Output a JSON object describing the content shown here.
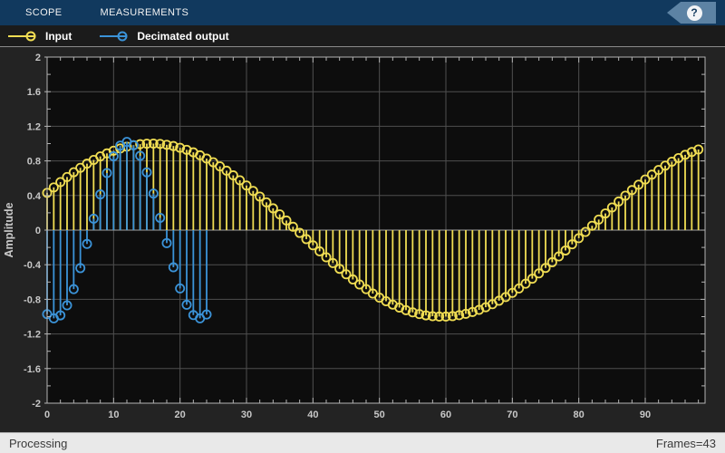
{
  "toolbar": {
    "tabs": [
      {
        "label": "SCOPE"
      },
      {
        "label": "MEASUREMENTS"
      }
    ],
    "help_label": "?"
  },
  "legend": {
    "items": [
      {
        "label": "Input",
        "color": "#f0dd53"
      },
      {
        "label": "Decimated output",
        "color": "#3b93d8"
      }
    ]
  },
  "status_bar": {
    "left": "Processing",
    "right": "Frames=43"
  },
  "colors": {
    "tabbar_bg": "#11395e",
    "help_tab_bg": "#5d83a4",
    "legend_bg": "#1b1b1b",
    "figure_bg": "#232323",
    "axes_bg": "#0d0d0d",
    "grid": "#4f4f4f",
    "baseline": "#a3a3a3",
    "axis_border": "#b4b4b4",
    "tick_label": "#c8c8c8",
    "input_series": "#f0dd53",
    "decimated_series": "#3b93d8",
    "status_bg": "#e9e9e9"
  },
  "chart_data": {
    "type": "stem",
    "title": "",
    "xlabel": "",
    "ylabel": "Amplitude",
    "xlim": [
      0,
      99
    ],
    "ylim": [
      -2,
      2
    ],
    "grid": true,
    "legend_position": "top-left",
    "x_ticks": {
      "values": [
        0,
        10,
        20,
        30,
        40,
        50,
        60,
        70,
        80,
        90
      ],
      "labels": [
        "0",
        "10",
        "20",
        "30",
        "40",
        "50",
        "60",
        "70",
        "80",
        "90"
      ],
      "minor_step": 2
    },
    "y_ticks": {
      "values": [
        -2,
        -1.6,
        -1.2,
        -0.8,
        -0.4,
        0,
        0.4,
        0.8,
        1.2,
        1.6,
        2
      ],
      "labels": [
        "-2",
        "-1.6",
        "-1.2",
        "-0.8",
        "-0.4",
        "0",
        "0.4",
        "0.8",
        "1.2",
        "1.6",
        "2"
      ],
      "minor_step": 0.2
    },
    "series": [
      {
        "name": "Input",
        "color": "#f0dd53",
        "x": [
          0,
          1,
          2,
          3,
          4,
          5,
          6,
          7,
          8,
          9,
          10,
          11,
          12,
          13,
          14,
          15,
          16,
          17,
          18,
          19,
          20,
          21,
          22,
          23,
          24,
          25,
          26,
          27,
          28,
          29,
          30,
          31,
          32,
          33,
          34,
          35,
          36,
          37,
          38,
          39,
          40,
          41,
          42,
          43,
          44,
          45,
          46,
          47,
          48,
          49,
          50,
          51,
          52,
          53,
          54,
          55,
          56,
          57,
          58,
          59,
          60,
          61,
          62,
          63,
          64,
          65,
          66,
          67,
          68,
          69,
          70,
          71,
          72,
          73,
          74,
          75,
          76,
          77,
          78,
          79,
          80,
          81,
          82,
          83,
          84,
          85,
          86,
          87,
          88,
          89,
          90,
          91,
          92,
          93,
          94,
          95,
          96,
          97,
          98
        ],
        "values": [
          0.431,
          0.494,
          0.555,
          0.614,
          0.669,
          0.72,
          0.768,
          0.812,
          0.852,
          0.887,
          0.918,
          0.944,
          0.965,
          0.982,
          0.993,
          0.999,
          1.0,
          0.996,
          0.986,
          0.972,
          0.952,
          0.928,
          0.899,
          0.865,
          0.827,
          0.784,
          0.737,
          0.687,
          0.633,
          0.576,
          0.516,
          0.453,
          0.388,
          0.321,
          0.252,
          0.182,
          0.111,
          0.039,
          -0.032,
          -0.104,
          -0.175,
          -0.245,
          -0.314,
          -0.381,
          -0.447,
          -0.51,
          -0.57,
          -0.628,
          -0.682,
          -0.733,
          -0.78,
          -0.822,
          -0.861,
          -0.895,
          -0.925,
          -0.95,
          -0.97,
          -0.985,
          -0.995,
          -0.999,
          -0.999,
          -0.994,
          -0.983,
          -0.967,
          -0.946,
          -0.921,
          -0.891,
          -0.856,
          -0.816,
          -0.773,
          -0.725,
          -0.674,
          -0.619,
          -0.561,
          -0.5,
          -0.437,
          -0.371,
          -0.304,
          -0.235,
          -0.164,
          -0.093,
          -0.021,
          0.05,
          0.122,
          0.193,
          0.262,
          0.331,
          0.398,
          0.463,
          0.525,
          0.585,
          0.641,
          0.695,
          0.745,
          0.791,
          0.833,
          0.87,
          0.903,
          0.932
        ]
      },
      {
        "name": "Decimated output",
        "color": "#3b93d8",
        "x": [
          0,
          1,
          2,
          3,
          4,
          5,
          6,
          7,
          8,
          9,
          10,
          11,
          12,
          13,
          14,
          15,
          16,
          17,
          18,
          19,
          20,
          21,
          22,
          23,
          24
        ],
        "values": [
          -0.971,
          -1.02,
          -0.985,
          -0.869,
          -0.682,
          -0.439,
          -0.16,
          0.132,
          0.413,
          0.66,
          0.853,
          0.977,
          1.02,
          0.98,
          0.859,
          0.668,
          0.423,
          0.142,
          -0.15,
          -0.429,
          -0.674,
          -0.863,
          -0.982,
          -1.02,
          -0.975
        ]
      }
    ]
  }
}
